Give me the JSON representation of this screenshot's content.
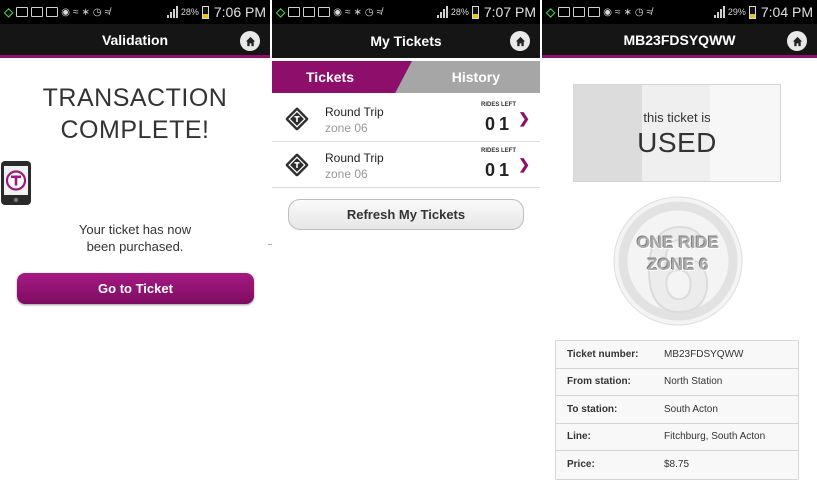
{
  "colors": {
    "brand": "#8e0f6b",
    "titlebar": "#151515",
    "tab_inactive": "#a6a6a6"
  },
  "screens": [
    {
      "status": {
        "battery_pct": "28%",
        "battery_level": 0.28,
        "time": "7:06 PM"
      },
      "title": "Validation",
      "heading_line1": "TRANSACTION",
      "heading_line2": "COMPLETE!",
      "icon": "phone-t-logo-icon",
      "message_line1": "Your ticket has now",
      "message_line2": "been purchased.",
      "button_label": "Go to Ticket"
    },
    {
      "status": {
        "battery_pct": "28%",
        "battery_level": 0.28,
        "time": "7:07 PM"
      },
      "title": "My Tickets",
      "tabs": [
        {
          "label": "Tickets",
          "active": true
        },
        {
          "label": "History",
          "active": false
        }
      ],
      "tickets": [
        {
          "name": "Round Trip",
          "zone": "zone 06",
          "rides_left_label": "RIDES LEFT",
          "rides_left": "01"
        },
        {
          "name": "Round Trip",
          "zone": "zone 06",
          "rides_left_label": "RIDES LEFT",
          "rides_left": "01"
        }
      ],
      "refresh_label": "Refresh My Tickets"
    },
    {
      "status": {
        "battery_pct": "29%",
        "battery_level": 0.29,
        "time": "7:04 PM"
      },
      "title": "MB23FDSYQWW",
      "used_small": "this ticket is",
      "used_big": "USED",
      "badge_line1": "ONE RIDE",
      "badge_line2": "ZONE 6",
      "badge_number": "6",
      "details": [
        {
          "label": "Ticket number:",
          "value": "MB23FDSYQWW"
        },
        {
          "label": "From station:",
          "value": "North Station"
        },
        {
          "label": "To station:",
          "value": "South Acton"
        },
        {
          "label": "Line:",
          "value": "Fitchburg, South Acton"
        },
        {
          "label": "Price:",
          "value": "$8.75"
        }
      ]
    }
  ]
}
